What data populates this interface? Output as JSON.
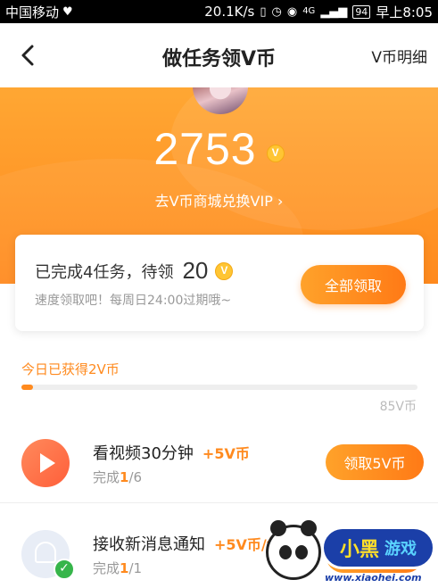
{
  "status_bar": {
    "carrier": "中国移动",
    "speed": "20.1K/s",
    "network": "4G",
    "battery": "94",
    "time": "早上8:05"
  },
  "navbar": {
    "title": "做任务领V币",
    "right_link": "V币明细"
  },
  "header": {
    "balance": "2753",
    "coin_symbol": "V",
    "shop_link": "去V币商城兑换VIP"
  },
  "summary": {
    "text_prefix": "已完成4任务，待领",
    "pending": "20",
    "hint": "速度领取吧！每周日24:00过期哦~",
    "claim_all_label": "全部领取"
  },
  "progress": {
    "label": "今日已获得2V币",
    "current": 2,
    "max": 85,
    "max_label": "85V币"
  },
  "tasks": [
    {
      "title": "看视频30分钟",
      "reward": "+5V币",
      "progress_prefix": "完成",
      "done": "1",
      "total": "/6",
      "button": "领取5V币",
      "icon": "play-icon"
    },
    {
      "title": "接收新消息通知",
      "reward": "+5V币/每",
      "progress_prefix": "完成",
      "done": "1",
      "total": "/1",
      "icon": "bell-icon",
      "completed": true
    }
  ],
  "watermark": {
    "brand": "小黑",
    "brand2": "游戏",
    "url": "www.xiaohei.com"
  },
  "colors": {
    "accent": "#ff8a1e",
    "header_top": "#ffa733",
    "success": "#36b54a"
  }
}
